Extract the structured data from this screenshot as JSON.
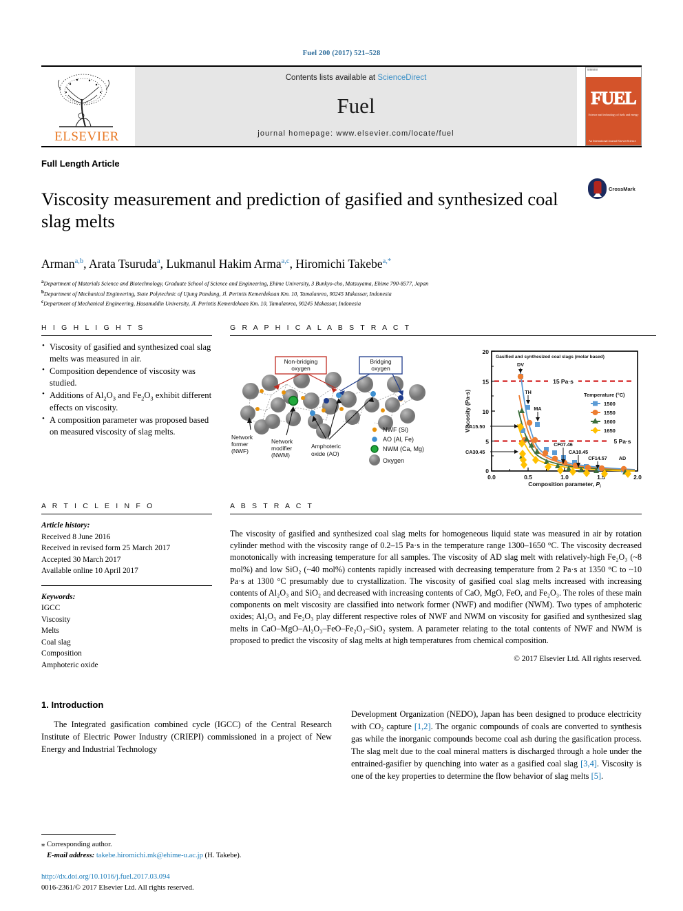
{
  "running_head": "Fuel 200 (2017) 521–528",
  "masthead": {
    "publisher": "ELSEVIER",
    "contents_prefix": "Contents lists available at ",
    "contents_link": "ScienceDirect",
    "journal_name": "Fuel",
    "homepage": "journal homepage: www.elsevier.com/locate/fuel",
    "cover_title": "FUEL",
    "cover_subtitle": "Science and technology of fuels and energy",
    "cover_footer": "An International Journal\nElsevierScience"
  },
  "article_type": "Full Length Article",
  "title": "Viscosity measurement and prediction of gasified and synthesized coal slag melts",
  "crossmark_label": "CrossMark",
  "authors": [
    {
      "name": "Arman",
      "sup": "a,b"
    },
    {
      "name": "Arata Tsuruda",
      "sup": "a"
    },
    {
      "name": "Lukmanul Hakim Arma",
      "sup": "a,c"
    },
    {
      "name": "Hiromichi Takebe",
      "sup": "a,*"
    }
  ],
  "affiliations": [
    {
      "mark": "a",
      "text": "Department of Materials Science and Biotechnology, Graduate School of Science and Engineering, Ehime University, 3 Bunkyo-cho, Matsuyama, Ehime 790-8577, Japan"
    },
    {
      "mark": "b",
      "text": "Department of Mechanical Engineering, State Polytechnic of Ujung Pandang, Jl. Perintis Kemerdekaan Km. 10, Tamalanrea, 90245 Makassar, Indonesia"
    },
    {
      "mark": "c",
      "text": "Department of Mechanical Engineering, Hasanuddin University, Jl. Perintis Kemerdekaan Km. 10, Tamalanrea, 90245 Makassar, Indonesia"
    }
  ],
  "highlights": {
    "heading": "H I G H L I G H T S",
    "items": [
      "Viscosity of gasified and synthesized coal slag melts was measured in air.",
      "Composition dependence of viscosity was studied.",
      "Additions of Al₂O₃ and Fe₂O₃ exhibit different effects on viscosity.",
      "A composition parameter was proposed based on measured viscosity of slag melts."
    ]
  },
  "graphical_abstract": {
    "heading": "G R A P H I C A L   A B S T R A C T",
    "diagram": {
      "callout_nonbridging": "Non-bridging oxygen",
      "callout_bridging": "Bridging oxygen",
      "label_nwf": "Network former (NWF)",
      "label_nwm": "Network modifier (NWM)",
      "label_ao": "Amphoteric oxide (AO)",
      "legend": [
        {
          "label": "NWF (Si)",
          "color": "#e8920a",
          "shape": "small-dot"
        },
        {
          "label": "AO (Al, Fe)",
          "color": "#3d8fd1",
          "shape": "small-dot"
        },
        {
          "label": "NWM (Ca, Mg)",
          "color": "#21a83c",
          "shape": "ring-dot"
        },
        {
          "label": "Oxygen",
          "color": "#8c8c8c",
          "shape": "big-sphere"
        }
      ]
    }
  },
  "chart_data": {
    "type": "scatter",
    "title": "Gasified and synthesized coal slags (molar based)",
    "xlabel": "Composition parameter, Pᵢ",
    "ylabel": "Viscosity (Pa·s)",
    "xlim": [
      0.0,
      2.0
    ],
    "ylim": [
      0,
      20
    ],
    "xticks": [
      "0.0",
      "0.5",
      "1.0",
      "1.5",
      "2.0"
    ],
    "yticks": [
      "0",
      "5",
      "10",
      "15",
      "20"
    ],
    "grid": false,
    "legend_title": "Temperature (°C)",
    "legend_position": "right-upper",
    "reference_lines": [
      {
        "label": "15 Pa·s",
        "y": 15,
        "color": "#cc0000",
        "style": "dashed"
      },
      {
        "label": "5 Pa·s",
        "y": 5,
        "color": "#cc0000",
        "style": "dashed"
      }
    ],
    "series": [
      {
        "name": "1500",
        "color": "#5b9bd5",
        "marker": "square",
        "points": [
          [
            0.38,
            16.2
          ],
          [
            0.47,
            11.0
          ],
          [
            0.6,
            8.3
          ],
          [
            0.4,
            7.5
          ],
          [
            0.52,
            5.2
          ],
          [
            0.6,
            5.1
          ],
          [
            0.7,
            2.1
          ],
          [
            0.85,
            1.8
          ],
          [
            0.93,
            1.0
          ],
          [
            1.0,
            0.9
          ],
          [
            1.15,
            0.5
          ],
          [
            1.3,
            0.4
          ],
          [
            1.55,
            0.3
          ],
          [
            1.85,
            0.2
          ]
        ]
      },
      {
        "name": "1550",
        "color": "#ed7d31",
        "marker": "circle",
        "points": [
          [
            0.38,
            15.6
          ],
          [
            0.47,
            7.0
          ],
          [
            0.52,
            5.2
          ],
          [
            0.6,
            5.1
          ],
          [
            0.4,
            5.0
          ],
          [
            0.7,
            1.6
          ],
          [
            0.85,
            1.2
          ],
          [
            0.93,
            0.7
          ],
          [
            1.0,
            0.6
          ],
          [
            1.15,
            0.35
          ],
          [
            1.3,
            0.3
          ],
          [
            1.55,
            0.25
          ],
          [
            1.85,
            0.2
          ]
        ]
      },
      {
        "name": "1600",
        "color": "#3c6e3c",
        "marker": "triangle",
        "points": [
          [
            0.42,
            9.8
          ],
          [
            0.47,
            4.8
          ],
          [
            0.52,
            4.0
          ],
          [
            0.6,
            3.3
          ],
          [
            0.4,
            2.4
          ],
          [
            0.7,
            1.0
          ],
          [
            0.85,
            0.7
          ],
          [
            0.93,
            0.5
          ],
          [
            1.0,
            0.4
          ],
          [
            1.15,
            0.3
          ],
          [
            1.3,
            0.25
          ],
          [
            1.55,
            0.2
          ],
          [
            1.85,
            0.15
          ]
        ]
      },
      {
        "name": "1650",
        "color": "#ffc000",
        "marker": "diamond",
        "points": [
          [
            0.4,
            6.5
          ],
          [
            0.42,
            4.2
          ],
          [
            0.43,
            3.1
          ],
          [
            0.44,
            2.4
          ],
          [
            0.45,
            1.6
          ],
          [
            0.47,
            1.1
          ],
          [
            0.6,
            1.4
          ],
          [
            0.7,
            0.8
          ],
          [
            0.85,
            0.5
          ],
          [
            0.93,
            0.4
          ],
          [
            1.0,
            0.3
          ],
          [
            1.15,
            0.25
          ],
          [
            1.3,
            0.2
          ],
          [
            1.55,
            0.18
          ],
          [
            1.85,
            0.12
          ]
        ]
      }
    ],
    "annotations": [
      {
        "label": "DV",
        "x": 0.38,
        "y": 17.5
      },
      {
        "label": "TH",
        "x": 0.47,
        "y": 12.4
      },
      {
        "label": "MA",
        "x": 0.6,
        "y": 9.8
      },
      {
        "label": "CA15.50",
        "x": 0.13,
        "y": 7.5
      },
      {
        "label": "CA30.45",
        "x": 0.13,
        "y": 4.1
      },
      {
        "label": "CF07.46",
        "x": 0.85,
        "y": 3.1
      },
      {
        "label": "CA10.45",
        "x": 0.98,
        "y": 2.4
      },
      {
        "label": "CF14.57",
        "x": 1.18,
        "y": 1.4
      },
      {
        "label": "AD",
        "x": 1.5,
        "y": 1.6
      }
    ]
  },
  "article_info": {
    "heading": "A R T I C L E   I N F O",
    "history_label": "Article history:",
    "history": [
      "Received 8 June 2016",
      "Received in revised form 25 March 2017",
      "Accepted 30 March 2017",
      "Available online 10 April 2017"
    ],
    "keywords_label": "Keywords:",
    "keywords": [
      "IGCC",
      "Viscosity",
      "Melts",
      "Coal slag",
      "Composition",
      "Amphoteric oxide"
    ]
  },
  "abstract": {
    "heading": "A B S T R A C T",
    "paragraphs": [
      "The viscosity of gasified and synthesized coal slag melts for homogeneous liquid state was measured in air by rotation cylinder method with the viscosity range of 0.2–15 Pa·s in the temperature range 1300–1650 °C. The viscosity decreased monotonically with increasing temperature for all samples. The viscosity of AD slag melt with relatively-high Fe₂O₃ (~8 mol%) and low SiO₂ (~40 mol%) contents rapidly increased with decreasing temperature from 2 Pa·s at 1350 °C to ~10 Pa·s at 1300 °C presumably due to crystallization. The viscosity of gasified coal slag melts increased with increasing contents of Al₂O₃ and SiO₂ and decreased with increasing contents of CaO, MgO, FeO, and Fe₂O₃. The roles of these main components on melt viscosity are classified into network former (NWF) and modifier (NWM). Two types of amphoteric oxides; Al₂O₃ and Fe₂O₃ play different respective roles of NWF and NWM on viscosity for gasified and synthesized slag melts in CaO–MgO–Al₂O₃–FeO–Fe₂O₃–SiO₂ system. A parameter relating to the total contents of NWF and NWM is proposed to predict the viscosity of slag melts at high temperatures from chemical composition."
    ],
    "copyright": "© 2017 Elsevier Ltd. All rights reserved."
  },
  "body": {
    "section_heading": "1. Introduction",
    "left_paragraph": "The Integrated gasification combined cycle (IGCC) of the Central Research Institute of Electric Power Industry (CRIEPI) commissioned in a project of New Energy and Industrial Technology",
    "right_paragraph_1": "Development Organization (NEDO), Japan has been designed to produce electricity with CO₂ capture ",
    "right_ref_1": "[1,2]",
    "right_paragraph_2": ". The organic compounds of coals are converted to synthesis gas while the inorganic compounds become coal ash during the gasification process. The slag melt due to the coal mineral matters is discharged through a hole under the entrained-gasifier by quenching into water as a gasified coal slag ",
    "right_ref_2": "[3,4]",
    "right_paragraph_3": ". Viscosity is one of the key properties to determine the flow behavior of slag melts ",
    "right_ref_3": "[5]",
    "right_paragraph_4": "."
  },
  "footer": {
    "corresponding_marker": "⁎",
    "corresponding_label": "Corresponding author.",
    "email_label": "E-mail address:",
    "email": "takebe.hiromichi.mk@ehime-u.ac.jp",
    "email_owner": "(H. Takebe).",
    "doi": "http://dx.doi.org/10.1016/j.fuel.2017.03.094",
    "issn_line": "0016-2361/© 2017 Elsevier Ltd. All rights reserved."
  }
}
